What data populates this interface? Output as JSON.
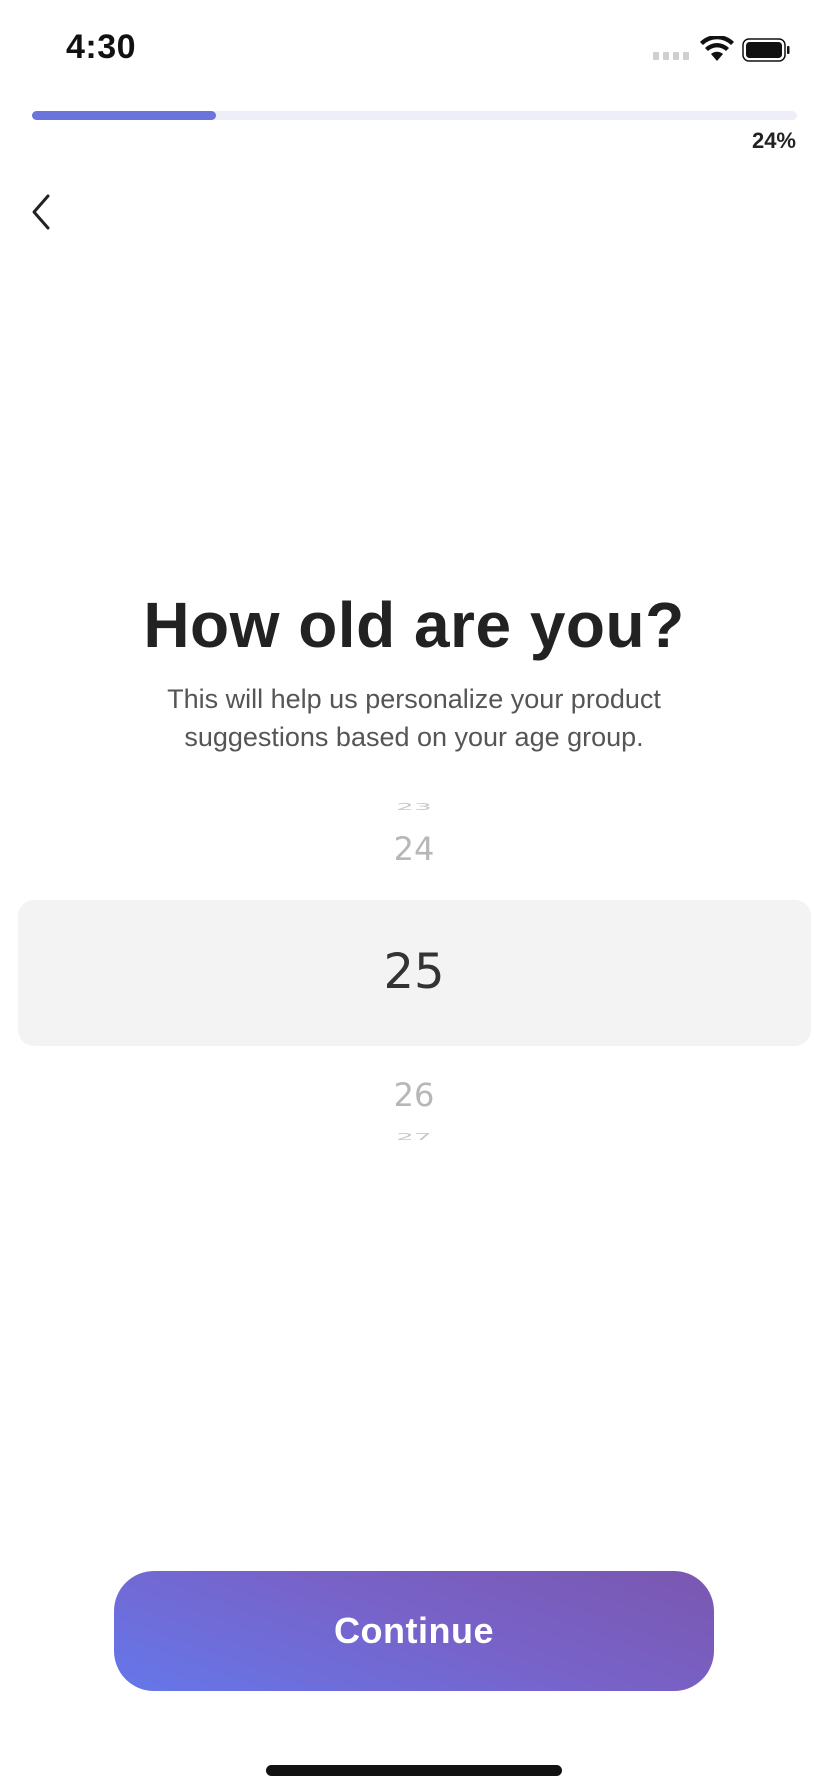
{
  "status_bar": {
    "time": "4:30",
    "signal_icon": "signal-dots-icon",
    "wifi_icon": "wifi-icon",
    "battery_icon": "battery-icon"
  },
  "progress": {
    "percent": 24,
    "label": "24%",
    "fill_color": "#6a74db",
    "track_color": "#eeeef9"
  },
  "nav": {
    "back_icon": "chevron-left-icon"
  },
  "question": {
    "title": "How old are you?",
    "subtitle": "This will help us personalize your product suggestions based on your age group."
  },
  "age_picker": {
    "values": [
      "23",
      "24",
      "25",
      "26",
      "27"
    ],
    "selected": "25"
  },
  "actions": {
    "continue_label": "Continue",
    "continue_gradient": [
      "#6577ea",
      "#7a57b0"
    ]
  }
}
